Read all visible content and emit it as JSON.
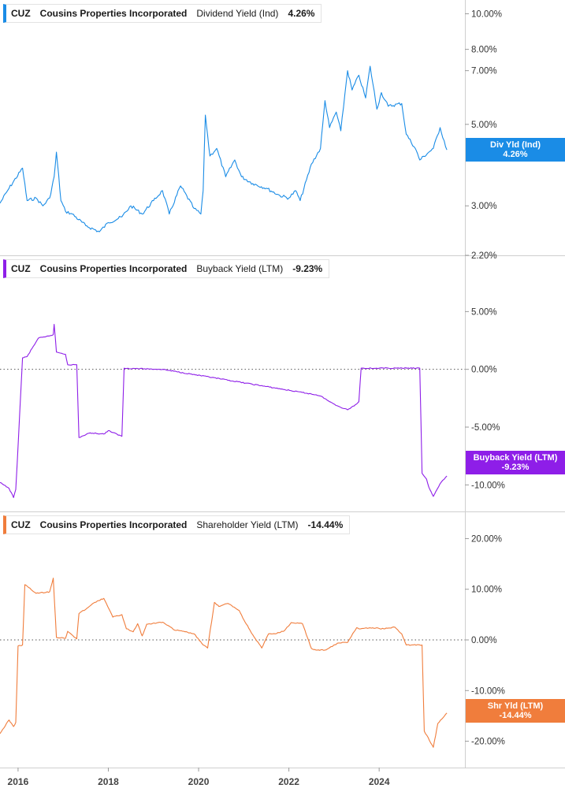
{
  "ticker": "CUZ",
  "company": "Cousins Properties Incorporated",
  "colors": {
    "dividend": "#1a8ce6",
    "buyback": "#8e1ee8",
    "shareholder": "#f07d3c"
  },
  "chart_data": [
    {
      "type": "line",
      "metric": "Dividend Yield (Ind)",
      "current_value": "4.26%",
      "tag_label": "Div Yld (Ind)",
      "tag_value": "4.26%",
      "y_scale": "log",
      "y_ticks": [
        "10.00%",
        "8.00%",
        "7.00%",
        "5.00%",
        "3.00%",
        "2.20%"
      ],
      "y_tick_values": [
        10,
        8,
        7,
        5,
        3,
        2.2
      ],
      "ylim": [
        2.2,
        10.9
      ],
      "xlim": [
        2015.6,
        2025.9
      ],
      "x": [
        2015.6,
        2015.8,
        2016.1,
        2016.2,
        2016.4,
        2016.55,
        2016.7,
        2016.8,
        2016.85,
        2016.95,
        2017.05,
        2017.2,
        2017.5,
        2017.8,
        2018.0,
        2018.3,
        2018.5,
        2018.75,
        2019.0,
        2019.2,
        2019.35,
        2019.6,
        2019.9,
        2020.05,
        2020.1,
        2020.15,
        2020.25,
        2020.4,
        2020.6,
        2020.8,
        2020.95,
        2021.2,
        2021.5,
        2021.8,
        2022.0,
        2022.15,
        2022.25,
        2022.5,
        2022.7,
        2022.8,
        2022.9,
        2023.05,
        2023.15,
        2023.3,
        2023.4,
        2023.55,
        2023.7,
        2023.8,
        2023.95,
        2024.05,
        2024.2,
        2024.5,
        2024.6,
        2024.8,
        2024.9,
        2025.1,
        2025.2,
        2025.35,
        2025.5
      ],
      "y": [
        3.05,
        3.35,
        3.8,
        3.1,
        3.15,
        3.0,
        3.15,
        3.6,
        4.2,
        3.1,
        2.9,
        2.85,
        2.65,
        2.55,
        2.7,
        2.8,
        3.0,
        2.85,
        3.1,
        3.3,
        2.85,
        3.4,
        2.95,
        2.85,
        3.3,
        5.3,
        4.1,
        4.3,
        3.6,
        4.0,
        3.6,
        3.45,
        3.35,
        3.2,
        3.15,
        3.3,
        3.1,
        3.9,
        4.3,
        5.8,
        4.9,
        5.4,
        4.8,
        7.0,
        6.2,
        6.8,
        5.9,
        7.2,
        5.5,
        6.1,
        5.6,
        5.7,
        4.7,
        4.3,
        4.0,
        4.2,
        4.3,
        4.9,
        4.26
      ]
    },
    {
      "type": "line",
      "metric": "Buyback Yield (LTM)",
      "current_value": "-9.23%",
      "tag_label": "Buyback Yield (LTM)",
      "tag_value": "-9.23%",
      "y_ticks": [
        "5.00%",
        "0.00%",
        "-5.00%",
        "-10.00%"
      ],
      "y_tick_values": [
        5,
        0,
        -5,
        -10
      ],
      "ylim": [
        -12.3,
        9.8
      ],
      "xlim": [
        2015.6,
        2025.9
      ],
      "x": [
        2015.6,
        2015.8,
        2015.9,
        2015.95,
        2016.1,
        2016.2,
        2016.45,
        2016.6,
        2016.78,
        2016.8,
        2016.85,
        2017.05,
        2017.1,
        2017.2,
        2017.3,
        2017.35,
        2017.6,
        2017.9,
        2018.0,
        2018.3,
        2018.35,
        2019.2,
        2022.6,
        2022.75,
        2022.9,
        2023.1,
        2023.3,
        2023.5,
        2023.55,
        2023.6,
        2024.0,
        2024.9,
        2024.95,
        2025.05,
        2025.1,
        2025.2,
        2025.35,
        2025.5
      ],
      "y": [
        -9.8,
        -10.3,
        -11.1,
        -10.4,
        1.0,
        1.1,
        2.7,
        2.8,
        3.0,
        3.9,
        1.5,
        1.3,
        0.4,
        0.4,
        0.4,
        -5.9,
        -5.5,
        -5.6,
        -5.3,
        -5.8,
        0.1,
        0.0,
        -2.2,
        -2.4,
        -2.8,
        -3.2,
        -3.5,
        -3.0,
        -2.8,
        0.1,
        0.1,
        0.1,
        -9.0,
        -9.5,
        -10.2,
        -11.0,
        -9.9,
        -9.23
      ]
    },
    {
      "type": "line",
      "metric": "Shareholder Yield (LTM)",
      "current_value": "-14.44%",
      "tag_label": "Shr Yld (LTM)",
      "tag_value": "-14.44%",
      "y_ticks": [
        "20.00%",
        "10.00%",
        "0.00%",
        "-10.00%",
        "-20.00%"
      ],
      "y_tick_values": [
        20,
        10,
        0,
        -10,
        -20
      ],
      "ylim": [
        -25.2,
        25.2
      ],
      "xlim": [
        2015.6,
        2025.9
      ],
      "x": [
        2015.6,
        2015.8,
        2015.9,
        2015.95,
        2016.0,
        2016.1,
        2016.15,
        2016.4,
        2016.7,
        2016.78,
        2016.85,
        2017.05,
        2017.1,
        2017.3,
        2017.35,
        2017.55,
        2017.7,
        2017.9,
        2018.1,
        2018.3,
        2018.4,
        2018.55,
        2018.65,
        2018.75,
        2018.85,
        2019.2,
        2019.35,
        2019.45,
        2019.7,
        2019.9,
        2020.1,
        2020.2,
        2020.35,
        2020.45,
        2020.65,
        2020.9,
        2021.0,
        2021.2,
        2021.4,
        2021.55,
        2021.7,
        2021.9,
        2022.05,
        2022.3,
        2022.5,
        2022.6,
        2022.8,
        2023.1,
        2023.3,
        2023.5,
        2023.55,
        2023.8,
        2024.1,
        2024.35,
        2024.5,
        2024.6,
        2024.95,
        2025.0,
        2025.2,
        2025.3,
        2025.5
      ],
      "y": [
        -18.5,
        -15.8,
        -17.1,
        -16.3,
        -1.2,
        -1.0,
        10.9,
        9.2,
        9.5,
        12.2,
        0.5,
        0.3,
        1.7,
        0.2,
        5.2,
        6.4,
        7.4,
        8.2,
        4.5,
        5.0,
        2.2,
        1.6,
        3.2,
        0.8,
        3.1,
        3.5,
        2.7,
        2.0,
        1.6,
        1.2,
        -1.0,
        -1.6,
        7.4,
        6.6,
        7.2,
        5.8,
        4.0,
        1.0,
        -1.6,
        1.2,
        1.2,
        1.8,
        3.4,
        3.2,
        -1.7,
        -2.0,
        -2.0,
        -0.6,
        -0.5,
        2.4,
        2.2,
        2.4,
        2.2,
        2.5,
        1.2,
        -1.0,
        -1.0,
        -18.0,
        -21.2,
        -16.5,
        -14.44
      ]
    }
  ],
  "x_axis": {
    "tick_labels": [
      "2016",
      "2018",
      "2020",
      "2022",
      "2024"
    ],
    "tick_values": [
      2016,
      2018,
      2020,
      2022,
      2024
    ]
  }
}
